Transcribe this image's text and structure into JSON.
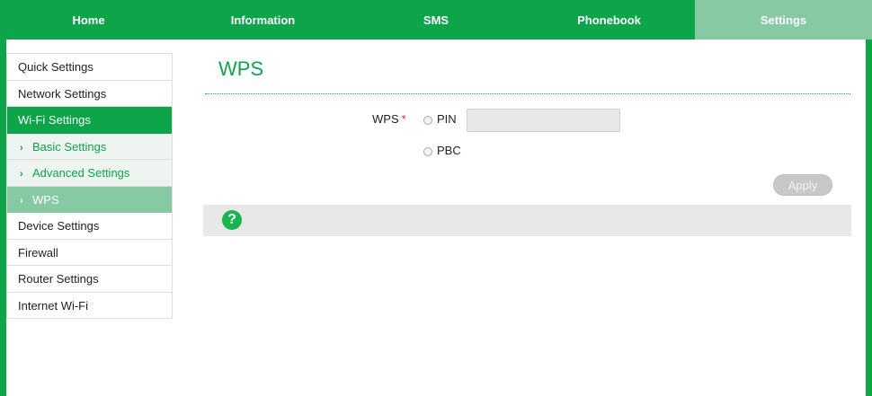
{
  "nav": {
    "tabs": [
      {
        "label": "Home"
      },
      {
        "label": "Information"
      },
      {
        "label": "SMS"
      },
      {
        "label": "Phonebook"
      },
      {
        "label": "Settings",
        "active": true
      }
    ]
  },
  "sidebar": {
    "items": [
      {
        "label": "Quick Settings"
      },
      {
        "label": "Network Settings"
      },
      {
        "label": "Wi-Fi Settings",
        "state": "group-active"
      },
      {
        "label": "Basic Settings",
        "sub": true
      },
      {
        "label": "Advanced Settings",
        "sub": true
      },
      {
        "label": "WPS",
        "sub": true,
        "selected": true
      },
      {
        "label": "Device Settings"
      },
      {
        "label": "Firewall"
      },
      {
        "label": "Router Settings"
      },
      {
        "label": "Internet Wi-Fi"
      }
    ],
    "chevron_icon": "chevron-right-icon"
  },
  "main": {
    "title": "WPS",
    "form": {
      "wps_label": "WPS",
      "required_mark": "*",
      "option_pin": "PIN",
      "option_pbc": "PBC",
      "pin_value": "",
      "pin_placeholder": "",
      "apply_label": "Apply"
    },
    "help": {
      "icon": "help-icon",
      "glyph": "?"
    }
  },
  "colors": {
    "brand_green": "#0da44a",
    "light_green": "#86c9a3",
    "required_red": "#e0262b",
    "disabled_gray": "#c8c8c8"
  }
}
